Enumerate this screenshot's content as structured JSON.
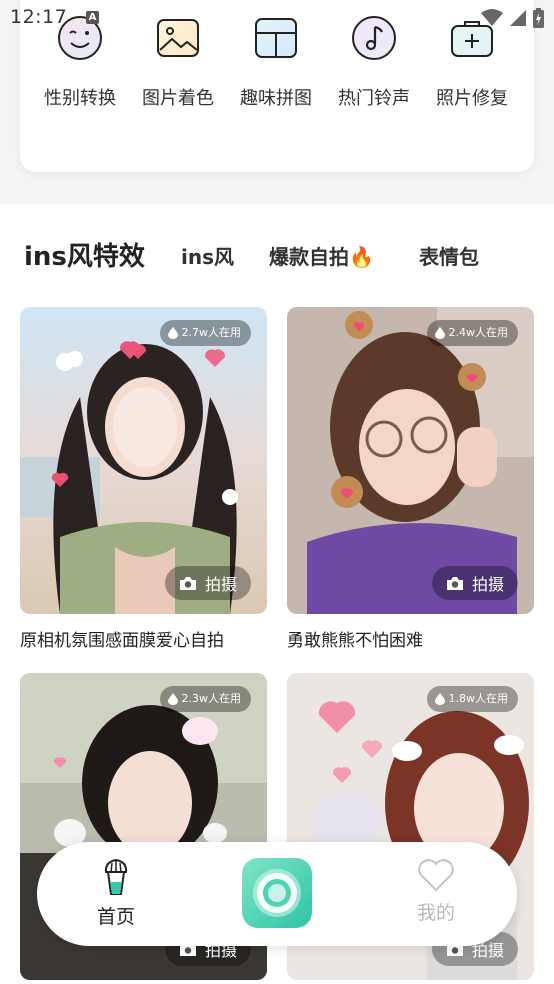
{
  "status_bar": {
    "time": "12:17",
    "a_icon": "A"
  },
  "tools": [
    {
      "label": "性别转换",
      "icon": "face-wink-icon"
    },
    {
      "label": "图片着色",
      "icon": "image-icon"
    },
    {
      "label": "趣味拼图",
      "icon": "collage-icon"
    },
    {
      "label": "热门铃声",
      "icon": "music-note-icon"
    },
    {
      "label": "照片修复",
      "icon": "medkit-icon"
    }
  ],
  "tabs": [
    {
      "label": "ins风特效",
      "active": true
    },
    {
      "label": "ins风"
    },
    {
      "label": "爆款自拍",
      "emoji": "🔥"
    },
    {
      "label": "表情包"
    }
  ],
  "cards": [
    {
      "title": "原相机氛围感面膜爱心自拍",
      "users": "2.7w人在用",
      "shoot": "拍摄"
    },
    {
      "title": "勇敢熊熊不怕困难",
      "users": "2.4w人在用",
      "shoot": "拍摄"
    },
    {
      "title": "",
      "users": "2.3w人在用",
      "shoot": "拍摄"
    },
    {
      "title": "",
      "users": "1.8w人在用",
      "shoot": "拍摄"
    }
  ],
  "bottom_nav": {
    "home": "首页",
    "mine": "我的"
  },
  "colors": {
    "accent": "#3cc7ab",
    "inactive": "#b9b9b9"
  }
}
